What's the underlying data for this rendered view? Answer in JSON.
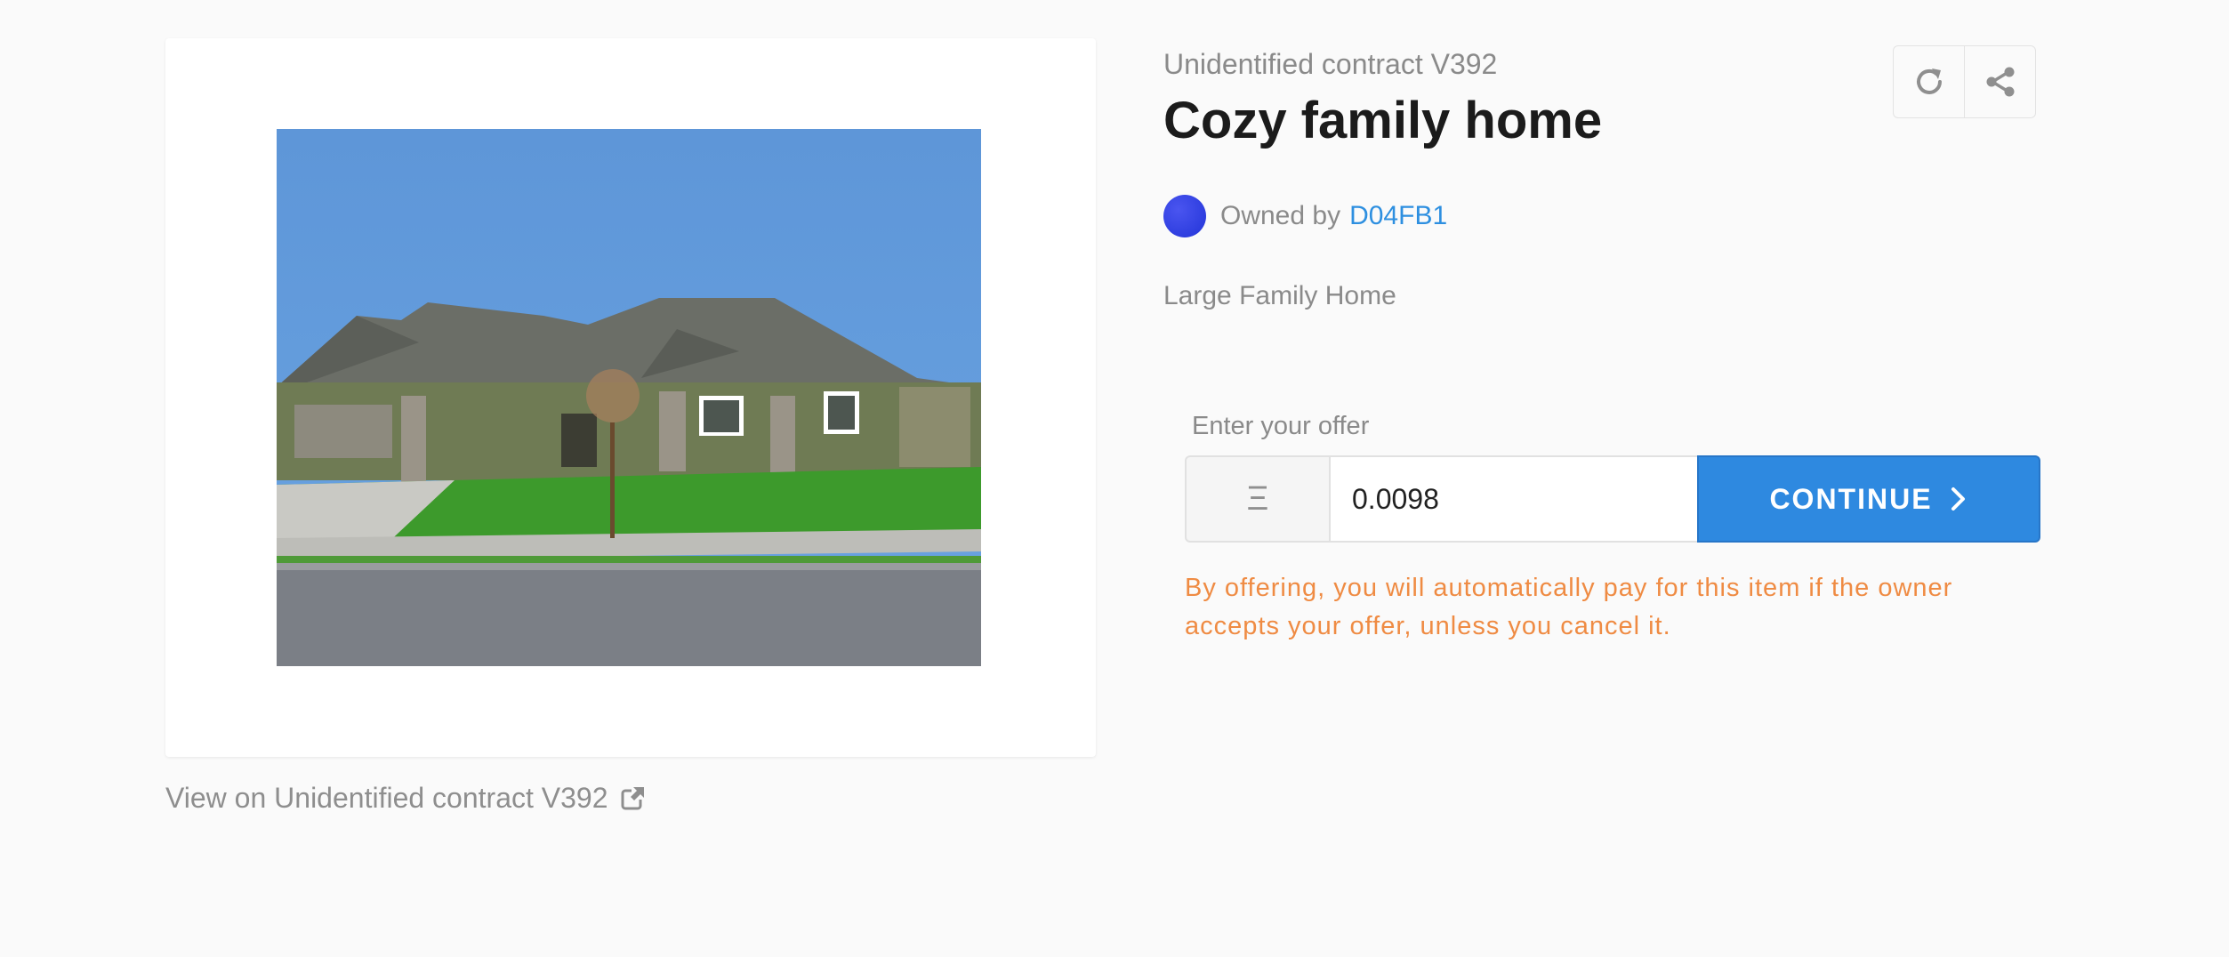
{
  "asset": {
    "contract_name": "Unidentified contract V392",
    "title": "Cozy family home",
    "owner_prefix": "Owned by",
    "owner_id": "D04FB1",
    "description": "Large Family Home",
    "image_icon": "house-photo",
    "view_link_label": "View on Unidentified contract V392",
    "view_link_icon": "external-link-icon"
  },
  "actions": {
    "refresh_icon": "refresh-icon",
    "share_icon": "share-icon"
  },
  "offer": {
    "label": "Enter your offer",
    "currency_symbol": "Ξ",
    "amount": "0.0098",
    "button_label": "CONTINUE",
    "button_icon": "chevron-right-icon",
    "disclaimer": "By offering, you will automatically pay for this item if the owner accepts your offer, unless you cancel it."
  },
  "colors": {
    "accent": "#2e89e0",
    "warning_text": "#ef8b43",
    "owner_link": "#2d8fe0",
    "avatar": "#2234d8"
  }
}
